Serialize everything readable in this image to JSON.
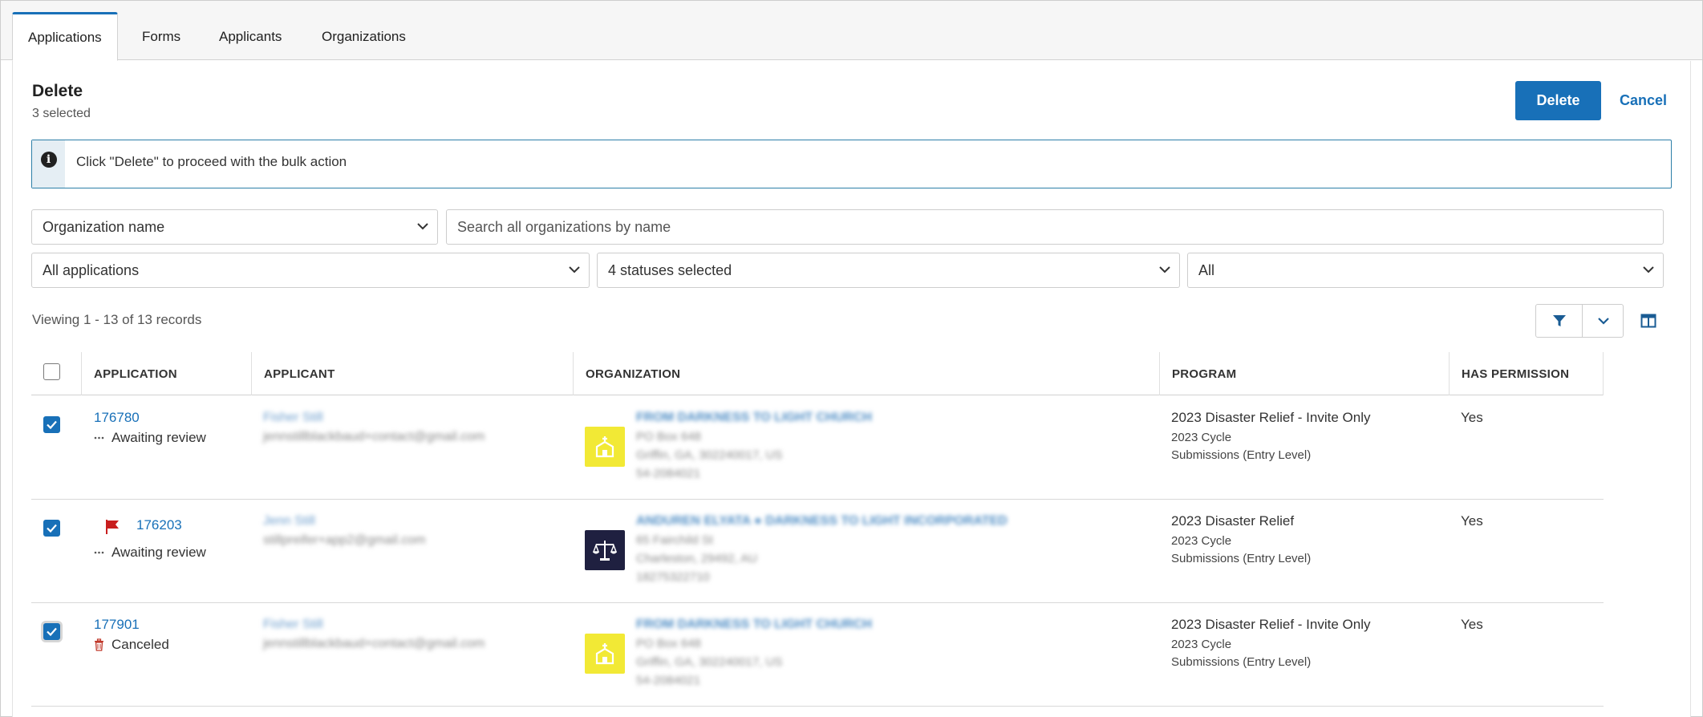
{
  "tabs": [
    {
      "label": "Applications",
      "active": true
    },
    {
      "label": "Forms",
      "active": false
    },
    {
      "label": "Applicants",
      "active": false
    },
    {
      "label": "Organizations",
      "active": false
    }
  ],
  "selection": {
    "title": "Delete",
    "count_text": "3 selected",
    "delete_label": "Delete",
    "cancel_label": "Cancel"
  },
  "info": {
    "message": "Click \"Delete\" to proceed with the bulk action"
  },
  "filters": {
    "org_field": "Organization name",
    "search_placeholder": "Search all organizations by name",
    "applications": "All applications",
    "statuses": "4 statuses selected",
    "all": "All"
  },
  "viewing": "Viewing 1 - 13 of 13 records",
  "table": {
    "headers": [
      "APPLICATION",
      "APPLICANT",
      "ORGANIZATION",
      "PROGRAM",
      "HAS PERMISSION"
    ],
    "rows": [
      {
        "id": "176780",
        "status": "Awaiting review",
        "status_icon": "ellipsis-icon",
        "flagged": false,
        "applicant_name": "Fisher Still",
        "applicant_email": "jennstillblackbaud+contact@gmail.com",
        "org_name": "FROM DARKNESS TO LIGHT CHURCH",
        "org_line1": "PO Box 648",
        "org_line2": "Griffin, GA, 302240017, US",
        "org_line3": "54-2084021",
        "org_logo": "church-icon",
        "program": "2023 Disaster Relief - Invite Only",
        "cycle": "2023 Cycle",
        "stage": "Submissions (Entry Level)",
        "permission": "Yes"
      },
      {
        "id": "176203",
        "status": "Awaiting review",
        "status_icon": "ellipsis-icon",
        "flagged": true,
        "applicant_name": "Jenn Still",
        "applicant_email": "stillpreifer+app2@gmail.com",
        "org_name": "ANDUREN ELYATA ● DARKNESS TO LIGHT INCORPORATED",
        "org_line1": "65 Fairchild St",
        "org_line2": "Charleston, 29492, AU",
        "org_line3": "18275322710",
        "org_logo": "scales-icon",
        "program": "2023 Disaster Relief",
        "cycle": "2023 Cycle",
        "stage": "Submissions (Entry Level)",
        "permission": "Yes"
      },
      {
        "id": "177901",
        "status": "Canceled",
        "status_icon": "trash-icon",
        "flagged": false,
        "applicant_name": "Fisher Still",
        "applicant_email": "jennstillblackbaud+contact@gmail.com",
        "org_name": "FROM DARKNESS TO LIGHT CHURCH",
        "org_line1": "PO Box 648",
        "org_line2": "Griffin, GA, 302240017, US",
        "org_line3": "54-2084021",
        "org_logo": "church-icon",
        "program": "2023 Disaster Relief - Invite Only",
        "cycle": "2023 Cycle",
        "stage": "Submissions (Entry Level)",
        "permission": "Yes"
      }
    ]
  },
  "colors": {
    "primary": "#1870b8",
    "info_border": "#2d7fa8",
    "flag": "#c81e1e",
    "trash": "#c0392b",
    "logo_yellow": "#f2e935",
    "logo_navy": "#1f2040"
  }
}
